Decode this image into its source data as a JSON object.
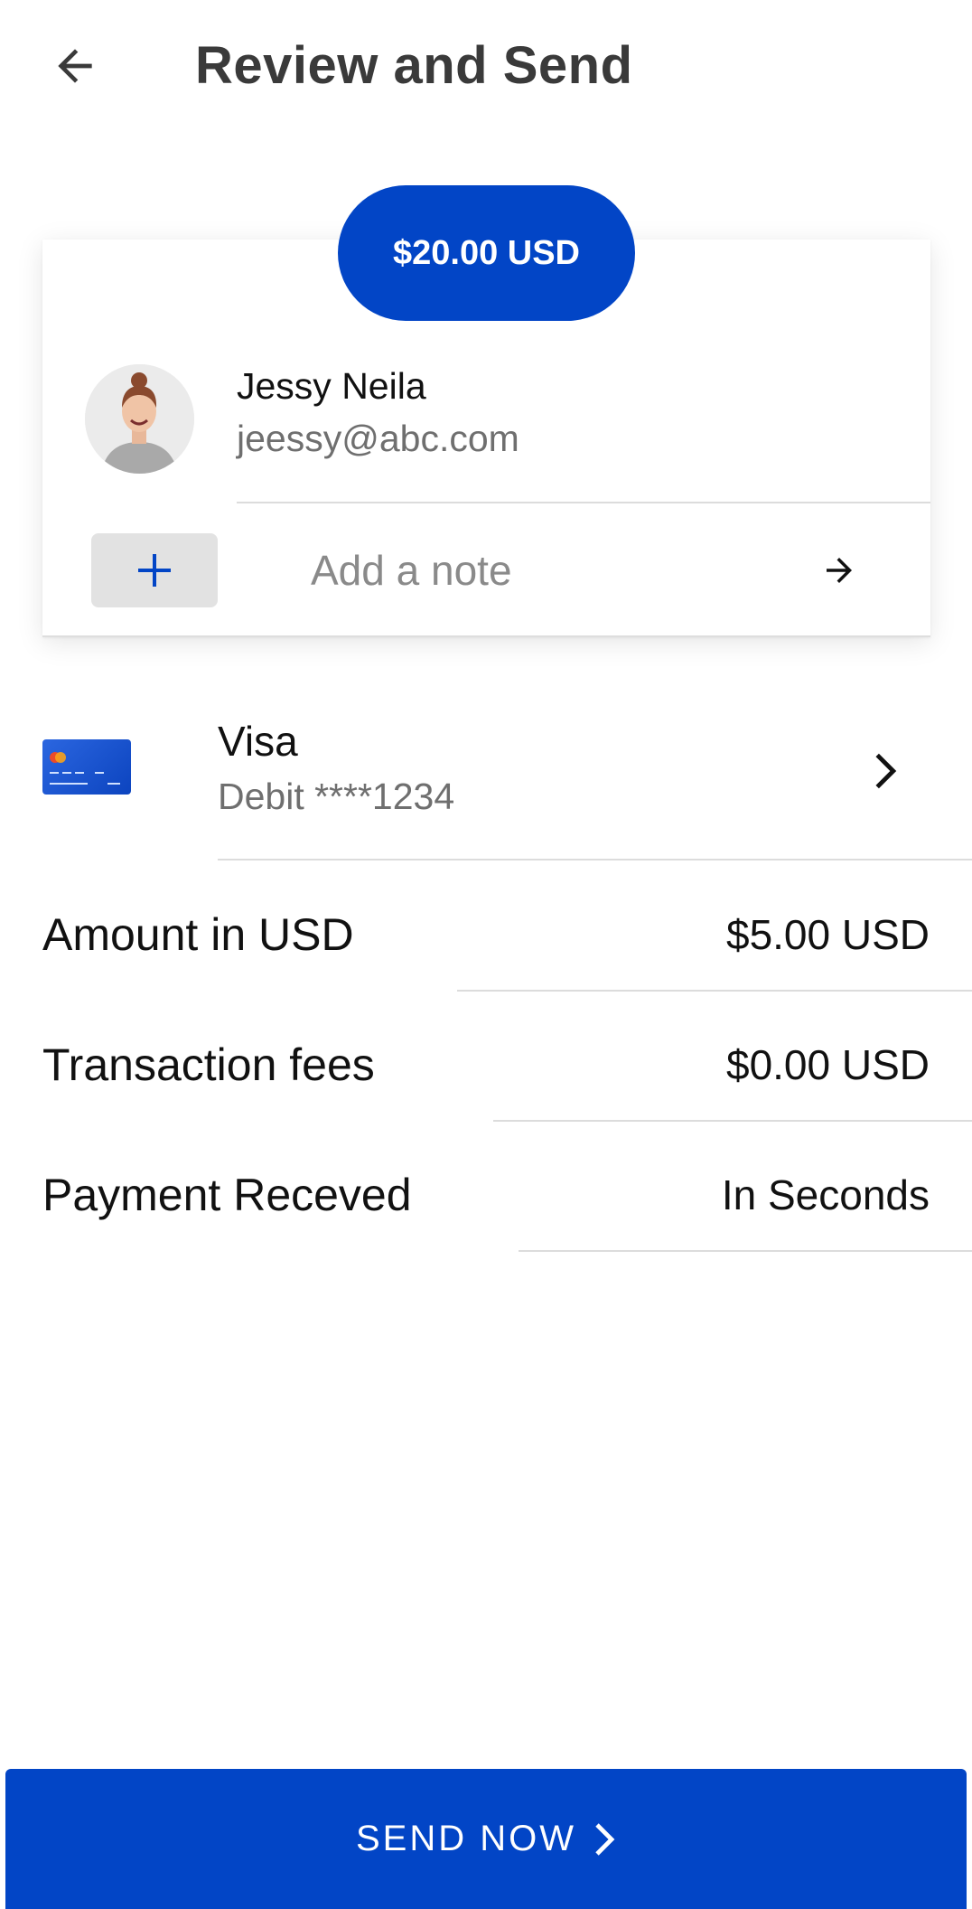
{
  "header": {
    "title": "Review and Send",
    "back_icon": "arrow-left-icon"
  },
  "transfer": {
    "amount": "$20.00 USD"
  },
  "recipient": {
    "name": "Jessy Neila",
    "email": "jeessy@abc.com"
  },
  "note": {
    "placeholder": "Add a note",
    "add_icon": "plus-icon",
    "submit_icon": "arrow-right-icon"
  },
  "payment_method": {
    "brand": "Visa",
    "detail": "Debit ****1234",
    "icon": "credit-card-icon"
  },
  "summary": [
    {
      "label": "Amount in USD",
      "value": "$5.00 USD"
    },
    {
      "label": "Transaction fees",
      "value": "$0.00 USD"
    },
    {
      "label": "Payment Receved",
      "value": "In Seconds"
    }
  ],
  "footer": {
    "send_label": "SEND NOW"
  },
  "colors": {
    "accent": "#0245c6",
    "muted_text": "#6f6f6f",
    "divider": "#dcdcdc"
  }
}
